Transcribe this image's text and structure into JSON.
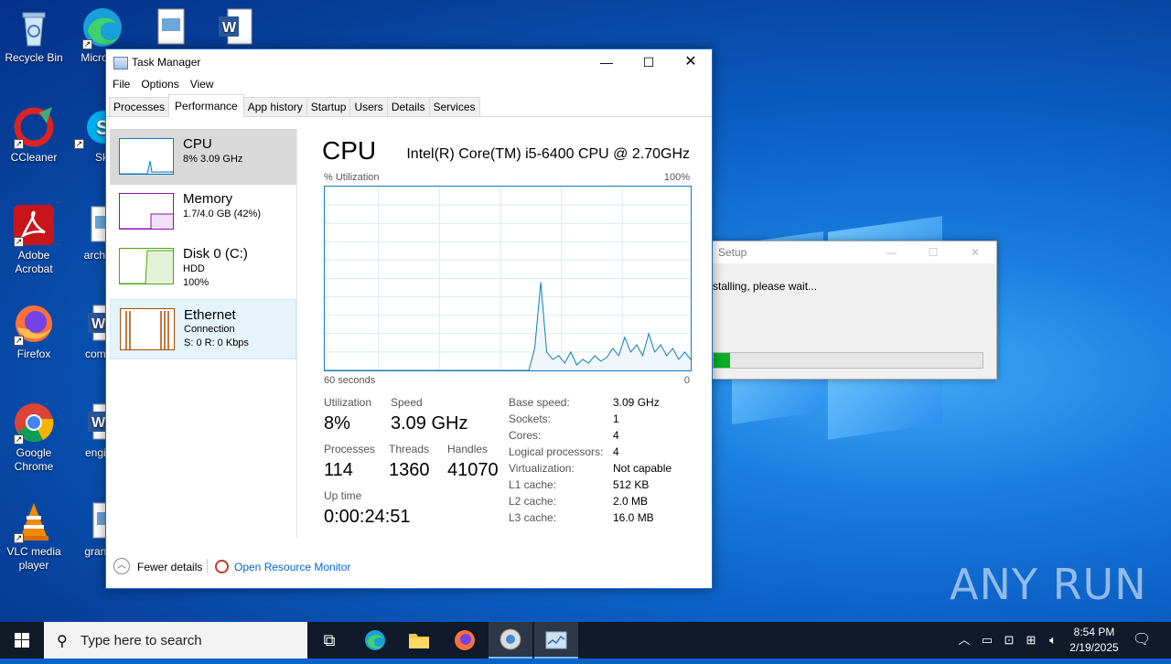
{
  "desktop": {
    "icons": [
      {
        "label": "Recycle Bin",
        "icon": "recycle-bin-icon"
      },
      {
        "label": "Micro Ed",
        "icon": "edge-icon"
      },
      {
        "label": "CCleaner",
        "icon": "ccleaner-icon"
      },
      {
        "label": "Sky",
        "icon": "skype-icon"
      },
      {
        "label": "Adobe Acrobat",
        "icon": "acrobat-icon"
      },
      {
        "label": "archive",
        "icon": "image-file-icon"
      },
      {
        "label": "Firefox",
        "icon": "firefox-icon"
      },
      {
        "label": "compu",
        "icon": "word-doc-icon"
      },
      {
        "label": "Google Chrome",
        "icon": "chrome-icon"
      },
      {
        "label": "engine",
        "icon": "word-doc-icon"
      },
      {
        "label": "VLC media player",
        "icon": "vlc-icon"
      },
      {
        "label": "grandd",
        "icon": "image-file-icon"
      }
    ]
  },
  "setup_window": {
    "title": "Setup",
    "message": "stalling, please wait...",
    "progress": 0.06
  },
  "task_manager": {
    "title": "Task Manager",
    "menu": [
      "File",
      "Options",
      "View"
    ],
    "tabs": [
      "Processes",
      "Performance",
      "App history",
      "Startup",
      "Users",
      "Details",
      "Services"
    ],
    "active_tab": "Performance",
    "sidebar": [
      {
        "name": "CPU",
        "sub1": "8%  3.09 GHz",
        "sub2": "",
        "color": "#117dbb"
      },
      {
        "name": "Memory",
        "sub1": "1.7/4.0 GB (42%)",
        "sub2": "",
        "color": "#8b12ae"
      },
      {
        "name": "Disk 0 (C:)",
        "sub1": "HDD",
        "sub2": "100%",
        "color": "#4da60c"
      },
      {
        "name": "Ethernet",
        "sub1": "Connection",
        "sub2": "S: 0  R: 0 Kbps",
        "color": "#a74f01"
      }
    ],
    "main": {
      "title": "CPU",
      "model": "Intel(R) Core(TM) i5-6400 CPU @ 2.70GHz",
      "util_label": "% Utilization",
      "max_label": "100%",
      "time_label": "60 seconds",
      "zero_label": "0",
      "stats": {
        "utilization_label": "Utilization",
        "utilization": "8%",
        "speed_label": "Speed",
        "speed": "3.09 GHz",
        "processes_label": "Processes",
        "processes": "114",
        "threads_label": "Threads",
        "threads": "1360",
        "handles_label": "Handles",
        "handles": "41070",
        "uptime_label": "Up time",
        "uptime": "0:00:24:51"
      },
      "specs": [
        {
          "label": "Base speed:",
          "value": "3.09 GHz"
        },
        {
          "label": "Sockets:",
          "value": "1"
        },
        {
          "label": "Cores:",
          "value": "4"
        },
        {
          "label": "Logical processors:",
          "value": "4"
        },
        {
          "label": "Virtualization:",
          "value": "Not capable"
        },
        {
          "label": "L1 cache:",
          "value": "512 KB"
        },
        {
          "label": "L2 cache:",
          "value": "2.0 MB"
        },
        {
          "label": "L3 cache:",
          "value": "16.0 MB"
        }
      ],
      "cpu_history": [
        0,
        0,
        0,
        0,
        0,
        0,
        0,
        0,
        0,
        0,
        0,
        0,
        0,
        0,
        0,
        0,
        0,
        0,
        0,
        0,
        0,
        0,
        0,
        0,
        0,
        0,
        0,
        0,
        0,
        0,
        0,
        0,
        0,
        0,
        0,
        12,
        48,
        10,
        6,
        8,
        4,
        10,
        3,
        6,
        4,
        8,
        5,
        7,
        12,
        8,
        18,
        10,
        14,
        8,
        20,
        10,
        14,
        8,
        12,
        6,
        10,
        6
      ]
    },
    "footer": {
      "fewer": "Fewer details",
      "resource_monitor": "Open Resource Monitor"
    }
  },
  "watermark": "ANY RUN",
  "taskbar": {
    "search_placeholder": "Type here to search",
    "time": "8:54 PM",
    "date": "2/19/2025"
  }
}
